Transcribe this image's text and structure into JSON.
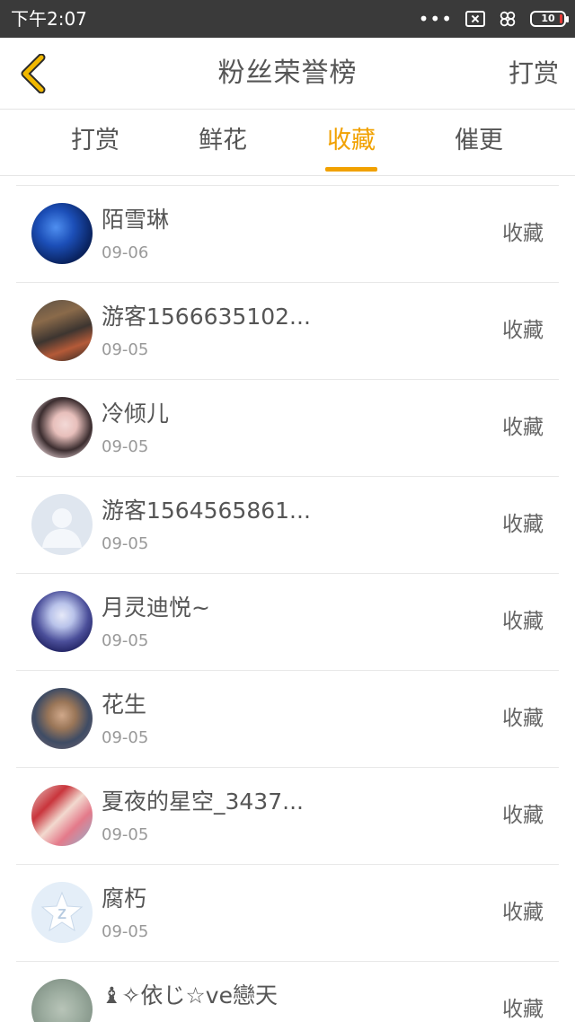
{
  "status_bar": {
    "time": "下午2:07",
    "more_glyph": "•••",
    "battery": "10",
    "icons": [
      "sim-off-icon",
      "clover-icon",
      "battery-icon"
    ]
  },
  "header": {
    "back_icon": "chevron-left-icon",
    "title": "粉丝荣誉榜",
    "action": "打赏",
    "accent_color": "#f1a100"
  },
  "tabs": [
    {
      "label": "打赏",
      "active": false
    },
    {
      "label": "鲜花",
      "active": false
    },
    {
      "label": "收藏",
      "active": true
    },
    {
      "label": "催更",
      "active": false
    }
  ],
  "fans": [
    {
      "name": "陌雪琳",
      "date": "09-06",
      "action": "收藏",
      "avatar": "galaxy-avatar"
    },
    {
      "name": "游客1566635102...",
      "date": "09-05",
      "action": "收藏",
      "avatar": "street-photo-avatar"
    },
    {
      "name": "冷倾儿",
      "date": "09-05",
      "action": "收藏",
      "avatar": "woman-portrait-avatar"
    },
    {
      "name": "游客1564565861...",
      "date": "09-05",
      "action": "收藏",
      "avatar": "default-user-avatar"
    },
    {
      "name": "月灵迪悦~",
      "date": "09-05",
      "action": "收藏",
      "avatar": "anime-girl-avatar"
    },
    {
      "name": "花生",
      "date": "09-05",
      "action": "收藏",
      "avatar": "warrior-avatar"
    },
    {
      "name": "夏夜的星空_3437...",
      "date": "09-05",
      "action": "收藏",
      "avatar": "girl-selfie-avatar"
    },
    {
      "name": "腐朽",
      "date": "09-05",
      "action": "收藏",
      "avatar": "qq-logo-avatar"
    },
    {
      "name": "♝✧依じ☆ve戀天",
      "date": "",
      "action": "收藏",
      "avatar": "sketch-avatar"
    }
  ]
}
